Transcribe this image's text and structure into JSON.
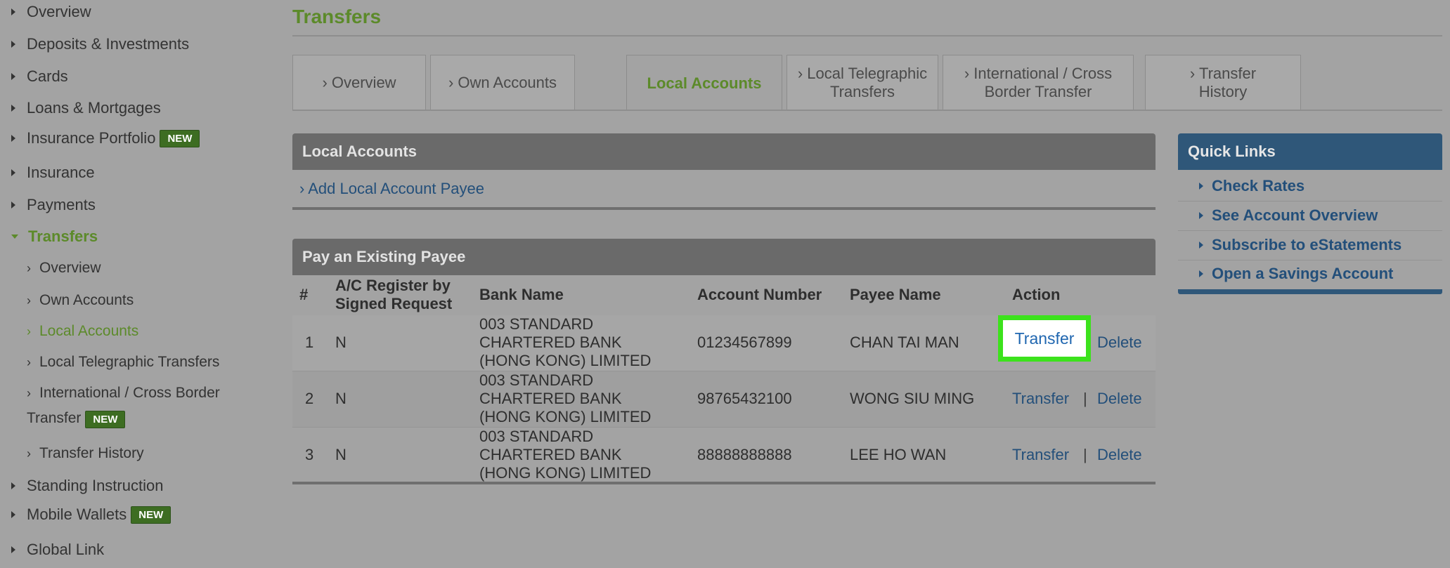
{
  "sidebar": {
    "items": [
      {
        "label": "Overview"
      },
      {
        "label": "Deposits & Investments"
      },
      {
        "label": "Cards"
      },
      {
        "label": "Loans & Mortgages"
      },
      {
        "label": "Insurance Portfolio",
        "badge": "NEW"
      },
      {
        "label": "Insurance"
      },
      {
        "label": "Payments"
      },
      {
        "label": "Transfers"
      },
      {
        "label": "Standing Instruction"
      },
      {
        "label": "Mobile Wallets",
        "badge": "NEW"
      },
      {
        "label": "Global Link"
      }
    ],
    "transfers_sub": [
      {
        "label": "Overview"
      },
      {
        "label": "Own Accounts"
      },
      {
        "label": "Local Accounts"
      },
      {
        "label": "Local Telegraphic Transfers"
      },
      {
        "label_line1": "International / Cross Border",
        "label_line2": "Transfer",
        "badge": "NEW"
      },
      {
        "label": "Transfer History"
      }
    ]
  },
  "page": {
    "title": "Transfers"
  },
  "tabs": [
    {
      "label": "› Overview"
    },
    {
      "label": "› Own Accounts"
    },
    {
      "label": "Local Accounts"
    },
    {
      "line1": "› Local Telegraphic",
      "line2": "Transfers"
    },
    {
      "line1": "› International / Cross",
      "line2": "Border Transfer"
    },
    {
      "line1": "› Transfer",
      "line2": "History"
    }
  ],
  "local_accounts": {
    "header": "Local Accounts",
    "add_link": "› Add Local Account Payee"
  },
  "payees": {
    "header": "Pay an Existing Payee",
    "columns": {
      "num": "#",
      "ac_line1": "A/C Register by",
      "ac_line2": "Signed Request",
      "bank": "Bank Name",
      "account": "Account Number",
      "payee": "Payee Name",
      "action": "Action"
    },
    "rows": [
      {
        "num": "1",
        "ac": "N",
        "bank1": "003 STANDARD",
        "bank2": "CHARTERED BANK",
        "bank3": "(HONG KONG) LIMITED",
        "account": "01234567899",
        "payee": "CHAN TAI MAN",
        "transfer": "Transfer",
        "sep": "|",
        "delete": "Delete"
      },
      {
        "num": "2",
        "ac": "N",
        "bank1": "003 STANDARD",
        "bank2": "CHARTERED BANK",
        "bank3": "(HONG KONG) LIMITED",
        "account": "98765432100",
        "payee": "WONG SIU MING",
        "transfer": "Transfer",
        "sep": "|",
        "delete": "Delete"
      },
      {
        "num": "3",
        "ac": "N",
        "bank1": "003 STANDARD",
        "bank2": "CHARTERED BANK",
        "bank3": "(HONG KONG) LIMITED",
        "account": "88888888888",
        "payee": "LEE HO WAN",
        "transfer": "Transfer",
        "sep": "|",
        "delete": "Delete"
      }
    ]
  },
  "quick_links": {
    "header": "Quick Links",
    "items": [
      {
        "label": "Check Rates"
      },
      {
        "label": "See Account Overview"
      },
      {
        "label": "Subscribe to eStatements"
      },
      {
        "label": "Open a Savings Account"
      }
    ]
  },
  "colors": {
    "accent_green": "#5c8a2a",
    "highlight": "#3ce21c",
    "link_blue": "#234f7a",
    "quicklinks_blue": "#2f5779"
  }
}
